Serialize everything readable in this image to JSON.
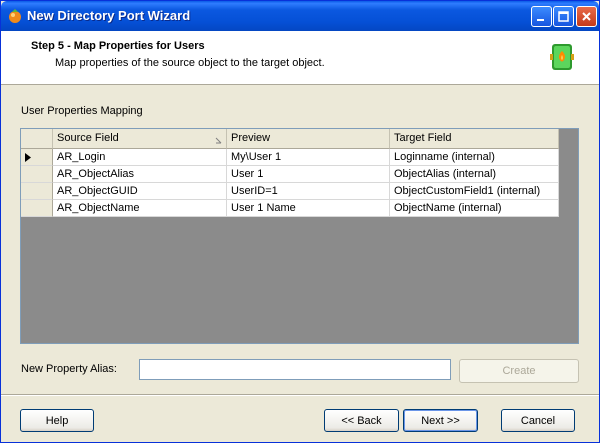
{
  "window": {
    "title": "New Directory Port Wizard"
  },
  "header": {
    "title": "Step 5 - Map Properties for Users",
    "subtitle": "Map properties of the source object to the target object."
  },
  "section": {
    "label": "User Properties Mapping"
  },
  "grid": {
    "columns": [
      "Source Field",
      "Preview",
      "Target Field"
    ],
    "rows": [
      {
        "source": "AR_Login",
        "preview": "My\\User 1",
        "target": "Loginname (internal)"
      },
      {
        "source": "AR_ObjectAlias",
        "preview": "User 1",
        "target": "ObjectAlias (internal)"
      },
      {
        "source": "AR_ObjectGUID",
        "preview": "UserID=1",
        "target": "ObjectCustomField1  (internal)"
      },
      {
        "source": "AR_ObjectName",
        "preview": "User 1 Name",
        "target": "ObjectName (internal)"
      }
    ]
  },
  "alias": {
    "label": "New Property Alias:",
    "value": "",
    "create_label": "Create"
  },
  "buttons": {
    "help": "Help",
    "back": "<< Back",
    "next": "Next >>",
    "cancel": "Cancel"
  },
  "icons": {
    "app": "wizard-app-icon",
    "header": "user-port-icon",
    "minimize": "minimize-icon",
    "maximize": "maximize-icon",
    "close": "close-icon",
    "sort": "sort-ascending-icon",
    "row_indicator": "current-row-arrow-icon"
  },
  "colors": {
    "titlebar": "#0550d6",
    "grid_background": "#8b8b8b",
    "dialog": "#ece9d8"
  }
}
